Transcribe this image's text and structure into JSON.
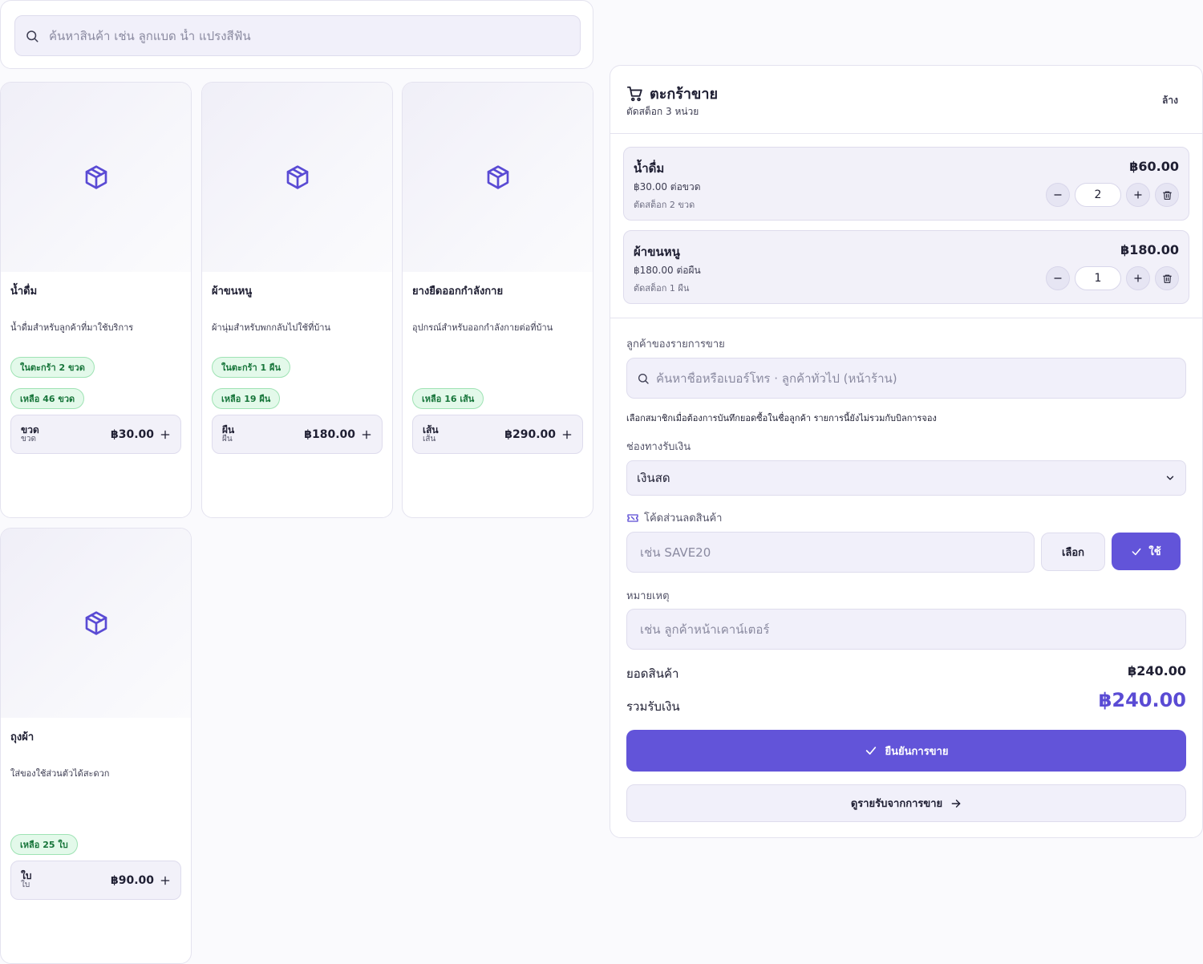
{
  "search": {
    "placeholder": "ค้นหาสินค้า เช่น ลูกแบด น้ำ แปรงสีฟัน"
  },
  "products": [
    {
      "name": "น้ำดื่ม",
      "description": "น้ำดื่มสำหรับลูกค้าที่มาใช้บริการ",
      "in_cart": "ในตะกร้า 2 ขวด",
      "remaining": "เหลือ 46 ขวด",
      "unit": "ขวด",
      "unit_sub": "ขวด",
      "price": "฿30.00"
    },
    {
      "name": "ผ้าขนหนู",
      "description": "ผ้านุ่มสำหรับพกกลับไปใช้ที่บ้าน",
      "in_cart": "ในตะกร้า 1 ผืน",
      "remaining": "เหลือ 19 ผืน",
      "unit": "ผืน",
      "unit_sub": "ผืน",
      "price": "฿180.00"
    },
    {
      "name": "ยางยืดออกกำลังกาย",
      "description": "อุปกรณ์สำหรับออกกำลังกายต่อที่บ้าน",
      "remaining": "เหลือ 16 เส้น",
      "unit": "เส้น",
      "unit_sub": "เส้น",
      "price": "฿290.00"
    },
    {
      "name": "ถุงผ้า",
      "description": "ใส่ของใช้ส่วนตัวได้สะดวก",
      "remaining": "เหลือ 25 ใบ",
      "unit": "ใบ",
      "unit_sub": "ใบ",
      "price": "฿90.00"
    }
  ],
  "cart": {
    "title": "ตะกร้าขาย",
    "subtitle": "ตัดสต็อก 3 หน่วย",
    "clear_label": "ล้าง",
    "items": [
      {
        "name": "น้ำดื่ม",
        "unit_price": "฿30.00 ต่อขวด",
        "stock_note": "ตัดสต็อก 2 ขวด",
        "total": "฿60.00",
        "qty": "2"
      },
      {
        "name": "ผ้าขนหนู",
        "unit_price": "฿180.00 ต่อผืน",
        "stock_note": "ตัดสต็อก 1 ผืน",
        "total": "฿180.00",
        "qty": "1"
      }
    ],
    "customer_label": "ลูกค้าของรายการขาย",
    "customer_placeholder": "ค้นหาชื่อหรือเบอร์โทร · ลูกค้าทั่วไป (หน้าร้าน)",
    "customer_hint": "เลือกสมาชิกเมื่อต้องการบันทึกยอดซื้อในชื่อลูกค้า รายการนี้ยังไม่รวมกับบิลการจอง",
    "payment_label": "ช่องทางรับเงิน",
    "payment_value": "เงินสด",
    "coupon_label": "โค้ดส่วนลดสินค้า",
    "coupon_placeholder": "เช่น SAVE20",
    "coupon_pick_label": "เลือก",
    "coupon_apply_label": "ใช้",
    "note_label": "หมายเหตุ",
    "note_placeholder": "เช่น ลูกค้าหน้าเคาน์เตอร์",
    "subtotal_label": "ยอดสินค้า",
    "subtotal_value": "฿240.00",
    "total_label": "รวมรับเงิน",
    "total_value": "฿240.00",
    "confirm_label": "ยืนยันการขาย",
    "report_label": "ดูรายรับจากการขาย"
  },
  "colors": {
    "accent": "#6254d9",
    "badge_bg": "#e3f9ea",
    "badge_text": "#17753a"
  },
  "icons": {
    "search": "search-icon",
    "product": "box-icon",
    "cart": "cart-icon",
    "coupon": "ticket-icon"
  }
}
